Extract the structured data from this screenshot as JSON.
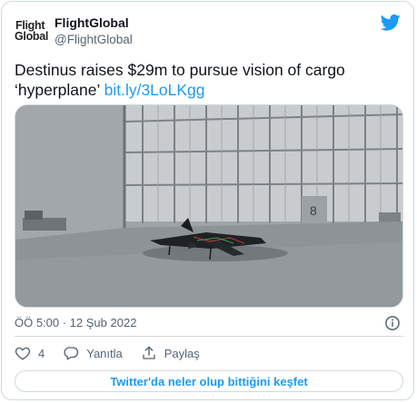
{
  "account": {
    "logo_line1": "Flight",
    "logo_line2": "Global",
    "name": "FlightGlobal",
    "handle": "@FlightGlobal"
  },
  "tweet": {
    "text": "Destinus raises $29m to pursue vision of cargo ‘hyperplane’ ",
    "link": "bit.ly/3LoLKgg",
    "timestamp": "ÖÖ 5:00 · 12 Şub 2022",
    "hangar_door_label": "8"
  },
  "actions": {
    "like_count": "4",
    "reply_label": "Yanıtla",
    "share_label": "Paylaş"
  },
  "cta": {
    "label": "Twitter'da neler olup bittiğini keşfet"
  },
  "colors": {
    "accent": "#1d9bf0",
    "muted": "#536471",
    "border": "#cfd9de"
  },
  "icons": [
    "twitter-bird-icon",
    "info-icon",
    "heart-icon",
    "reply-icon",
    "share-icon"
  ]
}
